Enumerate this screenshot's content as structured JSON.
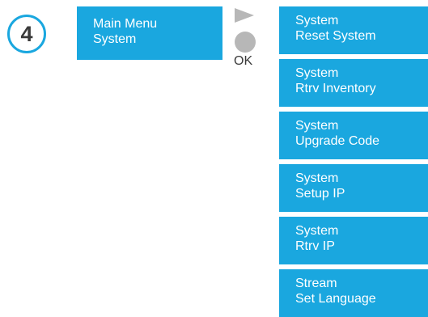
{
  "step": {
    "number": "4"
  },
  "current_menu": {
    "line1": "Main Menu",
    "line2": "System"
  },
  "controls": {
    "play_icon": "play-triangle",
    "ok_label": "OK"
  },
  "options": [
    {
      "line1": "System",
      "line2": "Reset System"
    },
    {
      "line1": "System",
      "line2": "Rtrv Inventory"
    },
    {
      "line1": "System",
      "line2": "Upgrade Code"
    },
    {
      "line1": "System",
      "line2": "Setup IP"
    },
    {
      "line1": "System",
      "line2": "Rtrv IP"
    },
    {
      "line1": "Stream",
      "line2": "Set Language"
    }
  ],
  "colors": {
    "accent": "#1aa7df",
    "control_gray": "#b7b7b7",
    "text_dark": "#3a3a3a"
  }
}
